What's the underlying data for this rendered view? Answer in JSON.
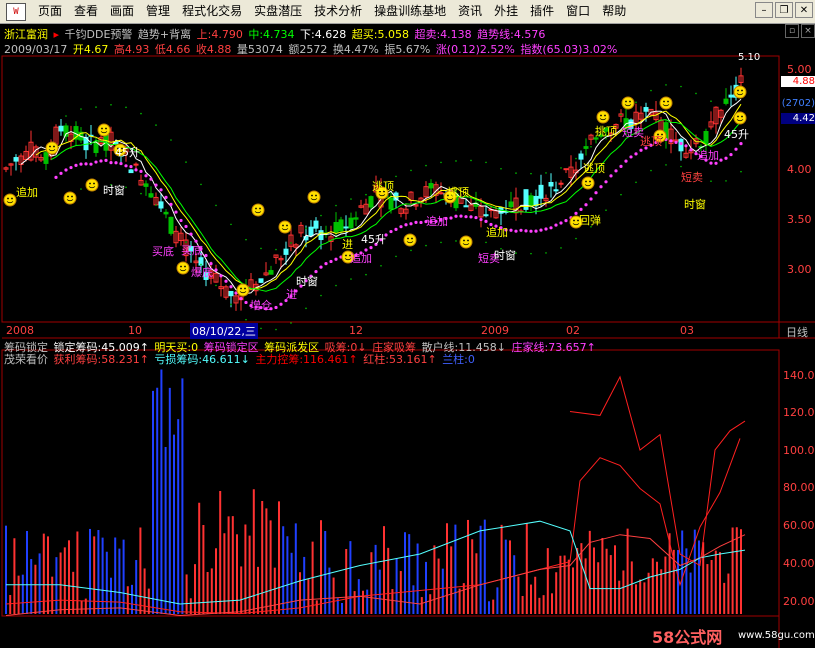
{
  "menu": {
    "logo": "W",
    "items": [
      "页面",
      "查看",
      "画面",
      "管理",
      "程式化交易",
      "实盘潜压",
      "技术分析",
      "操盘训练基地",
      "资讯",
      "外挂",
      "插件",
      "窗口",
      "帮助"
    ]
  },
  "stock": {
    "name": "浙江富润",
    "indicator_name": "千钧DDE预警",
    "indicator_sub": "趋势+背离",
    "up_label": "上:4.790",
    "mid_label": "中:4.734",
    "down_label": "下:4.628",
    "super_buy": "超买:5.058",
    "super_sell": "超卖:4.138",
    "trend_line": "趋势线:4.576"
  },
  "quote": {
    "date": "2009/03/17",
    "open": "开4.67",
    "high": "高4.93",
    "low": "低4.66",
    "close": "收4.88",
    "volume": "量53074",
    "amount": "额2572",
    "turnover": "换4.47%",
    "amplitude": "振5.67%",
    "change": "涨(0.12)2.52%",
    "index": "指数(65.03)3.02%"
  },
  "price_axis": {
    "ticks": [
      "5.00",
      "4.50",
      "4.00",
      "3.50",
      "3.00"
    ],
    "high_mark": "5.10",
    "current_price": "4.88",
    "code": "(2702)",
    "line_price": "4.42"
  },
  "time_axis": {
    "labels": [
      "2008",
      "10",
      "08/10/22,三",
      "12",
      "2009",
      "02",
      "03"
    ],
    "mode": "日线"
  },
  "chart_text": {
    "marks": [
      "追加",
      "时窗",
      "买底",
      "爆底",
      "增仓",
      "进",
      "追加",
      "时窗",
      "买底",
      "进",
      "逃顶",
      "追加",
      "挑顶",
      "短卖",
      "时窗",
      "逃顶",
      "回弹",
      "追加",
      "45升",
      "挑顶",
      "短卖",
      "追加",
      "时窗",
      "45升",
      "短卖",
      "逃顶"
    ],
    "percent_mark": "45升"
  },
  "chip_row": {
    "title": "筹码锁定",
    "locked": "锁定筹码:45.009↑",
    "tomorrow_buy": "明天买:0",
    "lock_zone": "筹码锁定区",
    "chip_dist": "筹码派发区",
    "absorb": "吸筹:0↓",
    "dealer_absorb": "庄家吸筹",
    "retail_line": "散户线:11.458↓",
    "dealer_line": "庄家线:73.657↑"
  },
  "lower_panel": {
    "title": "茂荣看价",
    "profit_chip": "获利筹码:58.231↑",
    "loss_chip": "亏损筹码:46.611↓",
    "main_control": "主力控筹:116.461↑",
    "red_column": "红柱:53.161↑",
    "blue_column": "兰柱:0",
    "ticks": [
      "140.00",
      "120.00",
      "100.00",
      "80.00",
      "60.00",
      "40.00",
      "20.00"
    ]
  },
  "watermark": {
    "brand": "58公式网",
    "url": "www.58gu.com"
  },
  "colors": {
    "up_candle": "#ff3232",
    "down_candle": "#54ffff",
    "green_candle": "#00c000",
    "ma_white": "#ffffff",
    "ma_yellow": "#ffff00",
    "magenta_dots": "#ff40ff",
    "axis_red": "#a00000",
    "grid": "#800000"
  }
}
